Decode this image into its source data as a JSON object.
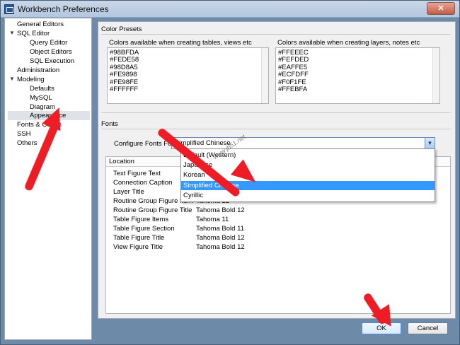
{
  "window": {
    "title": "Workbench Preferences",
    "close_glyph": "✕"
  },
  "sidebar": {
    "items": [
      {
        "label": "General Editors",
        "level": 0
      },
      {
        "label": "SQL Editor",
        "level": 0,
        "expanded": true
      },
      {
        "label": "Query Editor",
        "level": 1
      },
      {
        "label": "Object Editors",
        "level": 1
      },
      {
        "label": "SQL Execution",
        "level": 1
      },
      {
        "label": "Administration",
        "level": 0
      },
      {
        "label": "Modeling",
        "level": 0,
        "expanded": true
      },
      {
        "label": "Defaults",
        "level": 1
      },
      {
        "label": "MySQL",
        "level": 1
      },
      {
        "label": "Diagram",
        "level": 1
      },
      {
        "label": "Appearance",
        "level": 1,
        "selected": true
      },
      {
        "label": "Fonts & Colors",
        "level": 0
      },
      {
        "label": "SSH",
        "level": 0
      },
      {
        "label": "Others",
        "level": 0
      }
    ]
  },
  "color_presets": {
    "group_label": "Color Presets",
    "tables_title": "Colors available when creating tables, views etc",
    "tables_colors": [
      "#98BFDA",
      "#FEDE58",
      "#98D8A5",
      "#FE9898",
      "#FE98FE",
      "#FFFFFF"
    ],
    "layers_title": "Colors available when creating layers, notes etc",
    "layers_colors": [
      "#FFEEEC",
      "#FEFDED",
      "#EAFFE5",
      "#ECFDFF",
      "#F0F1FE",
      "#FFEBFA"
    ]
  },
  "fonts": {
    "group_label": "Fonts",
    "configure_label": "Configure Fonts For:",
    "selected": "Simplified Chinese",
    "dropdown_glyph": "▼",
    "options": [
      "Default (Western)",
      "Japanese",
      "Korean",
      "Simplified Chinese",
      "Cyrillic"
    ],
    "table_header_location": "Location",
    "rows": [
      {
        "location": "Text Figure Text",
        "font": ""
      },
      {
        "location": "Connection Caption",
        "font": ""
      },
      {
        "location": "Layer Title",
        "font": ""
      },
      {
        "location": "Routine Group Figure Item",
        "font": "Tahoma 12"
      },
      {
        "location": "Routine Group Figure Title",
        "font": "Tahoma Bold 12"
      },
      {
        "location": "Table Figure Items",
        "font": "Tahoma 11"
      },
      {
        "location": "Table Figure Section",
        "font": "Tahoma Bold 11"
      },
      {
        "location": "Table Figure Title",
        "font": "Tahoma Bold 12"
      },
      {
        "location": "View Figure Title",
        "font": "Tahoma Bold 12"
      }
    ]
  },
  "buttons": {
    "ok": "OK",
    "cancel": "Cancel"
  },
  "watermark": "www.jb51.net"
}
